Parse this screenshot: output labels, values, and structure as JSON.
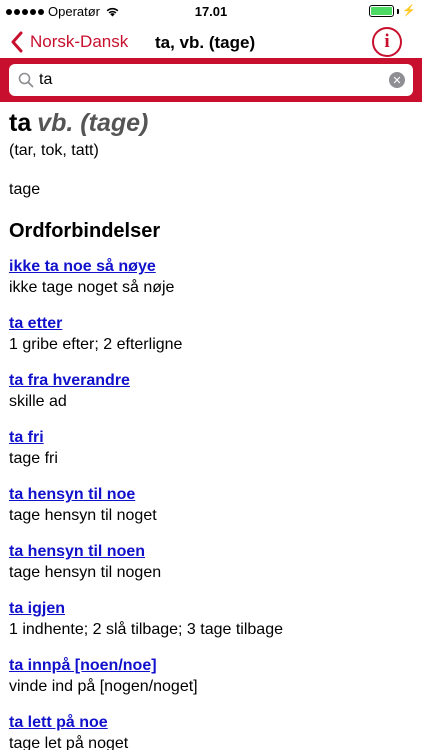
{
  "status_bar": {
    "carrier": "Operatør",
    "time": "17.01"
  },
  "nav": {
    "back_label": "Norsk-Dansk",
    "title": "ta, vb. (tage)",
    "info_label": "i"
  },
  "search": {
    "value": "ta"
  },
  "entry": {
    "headword": "ta",
    "pos": "vb. (tage)",
    "inflection": "(tar, tok, tatt)",
    "translation": "tage"
  },
  "section_title": "Ordforbindelser",
  "phrases": [
    {
      "phrase": "ikke ta noe så nøye",
      "meaning": "ikke tage noget så nøje"
    },
    {
      "phrase": "ta etter",
      "meaning": "1 gribe efter; 2 efterligne"
    },
    {
      "phrase": "ta fra hverandre",
      "meaning": "skille ad"
    },
    {
      "phrase": "ta fri",
      "meaning": "tage fri"
    },
    {
      "phrase": "ta hensyn til noe",
      "meaning": "tage hensyn til noget"
    },
    {
      "phrase": "ta hensyn til noen",
      "meaning": "tage hensyn til nogen"
    },
    {
      "phrase": "ta igjen",
      "meaning": "1 indhente; 2 slå tilbage; 3 tage tilbage"
    },
    {
      "phrase": "ta innpå [noen/noe]",
      "meaning": "vinde ind på [nogen/noget]"
    },
    {
      "phrase": "ta lett på noe",
      "meaning": "tage let på noget"
    }
  ],
  "colors": {
    "accent": "#c8102e",
    "link": "#1111cc",
    "battery": "#4cd964"
  }
}
